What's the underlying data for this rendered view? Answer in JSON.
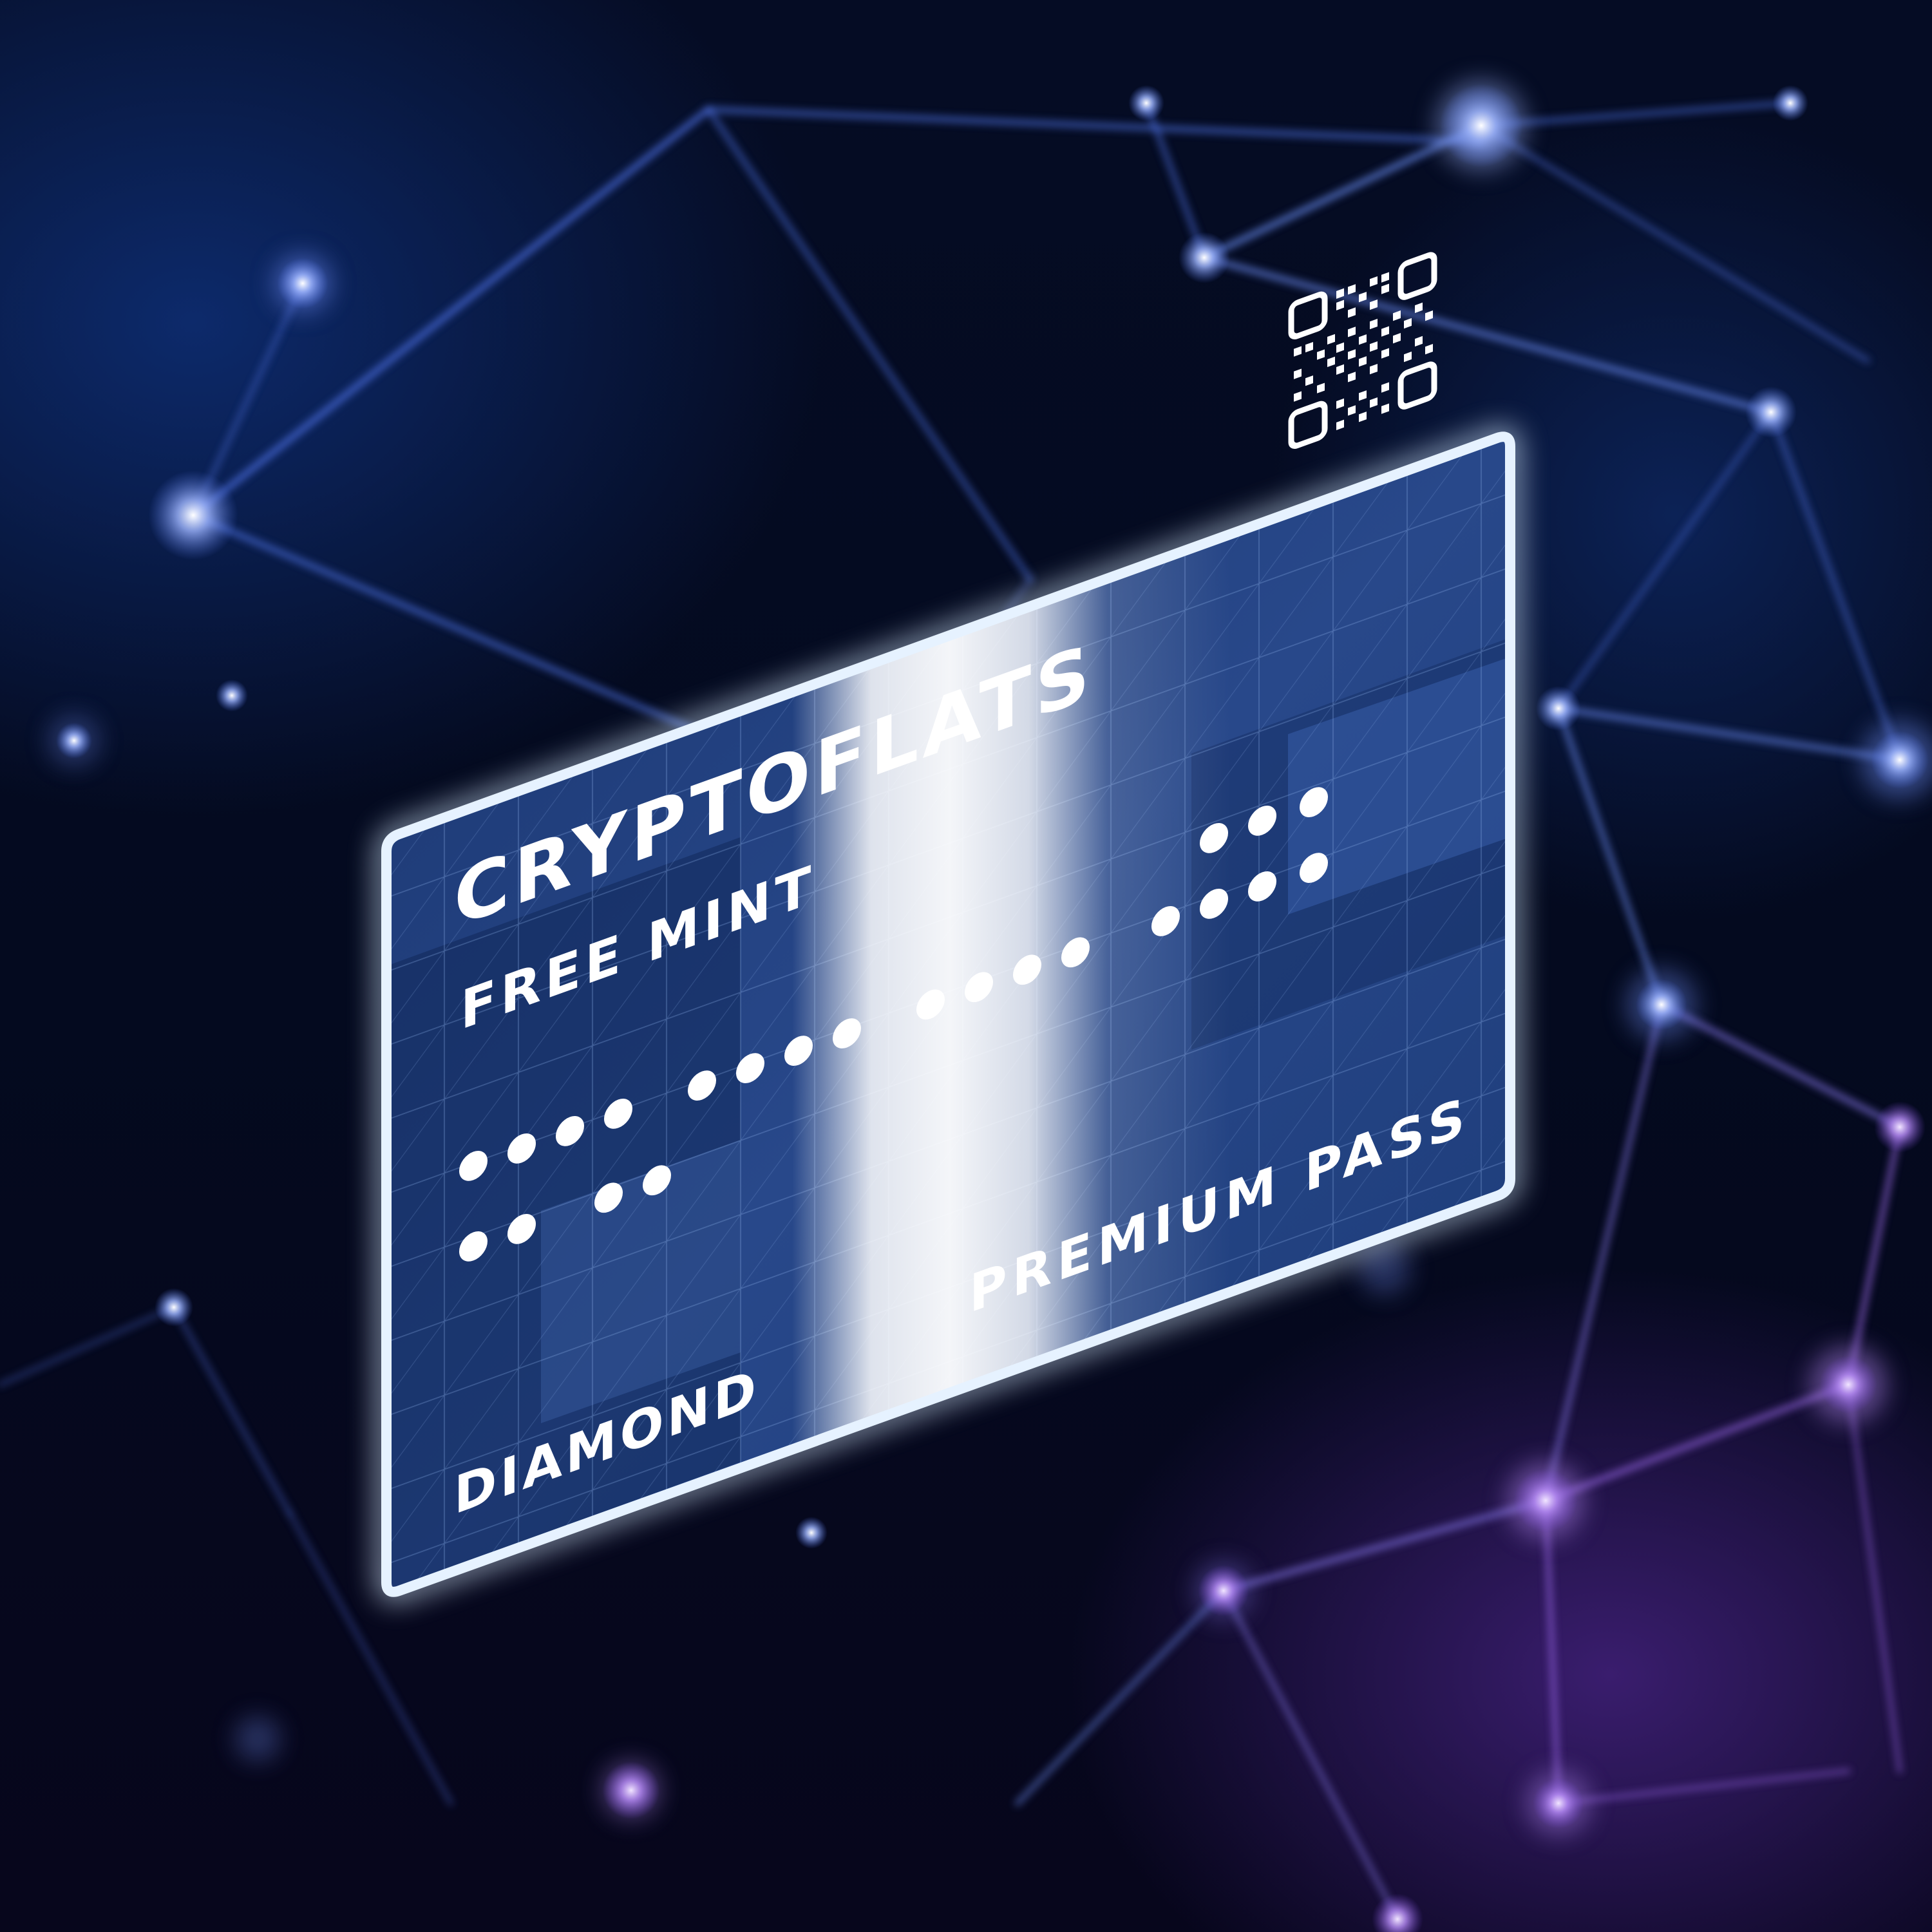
{
  "card": {
    "brand": "CRYPTOFLATS",
    "subtitle": "FREE MINT",
    "tier": "DIAMOND",
    "pass_label": "PREMIUM PASS",
    "qr_icon": "qr-code-icon"
  },
  "colors": {
    "background": "#040a1f",
    "card_base": "#1e3e78",
    "card_border": "#e6f2ff",
    "highlight": "#ffffff",
    "network_lines": "#4d6fe0",
    "network_nodes": "#9fb6ff",
    "accent_purple": "#a06cf0"
  }
}
